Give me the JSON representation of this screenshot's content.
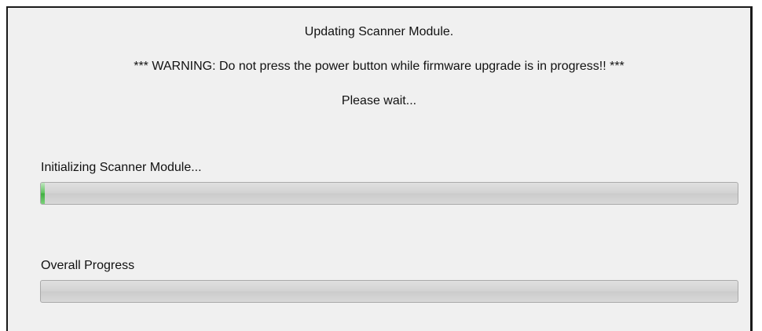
{
  "dialog": {
    "title": "Updating Scanner Module.",
    "warning": "*** WARNING: Do not press the power button while firmware upgrade is in progress!! ***",
    "wait": "Please wait..."
  },
  "progress": {
    "module": {
      "label": "Initializing Scanner Module...",
      "fraction": 0.005,
      "color": "#4caf50"
    },
    "overall": {
      "label": "Overall Progress",
      "fraction": 0
    }
  }
}
